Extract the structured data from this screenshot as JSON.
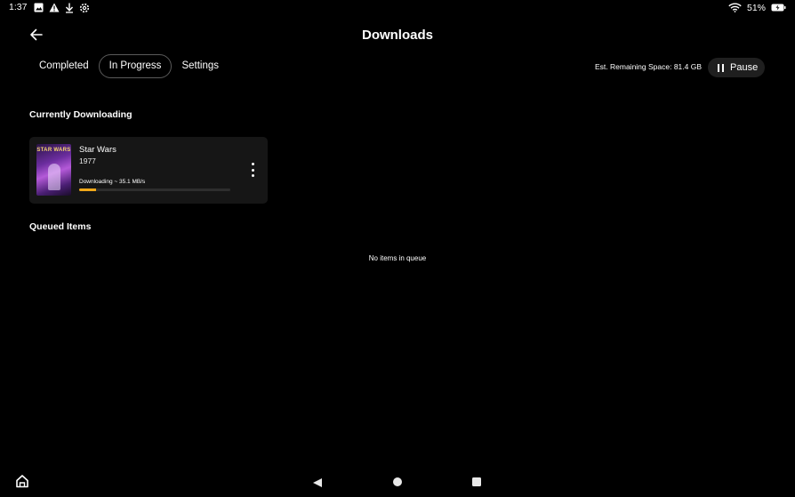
{
  "status_bar": {
    "time": "1:37",
    "left_icons": [
      "image-icon",
      "warning-icon",
      "download-icon",
      "settings-gear-icon"
    ],
    "battery_percent": "51%",
    "right_icons": [
      "wifi-icon",
      "battery-charging-icon"
    ]
  },
  "header": {
    "title": "Downloads",
    "back_icon": "back-arrow-icon"
  },
  "tabs": [
    {
      "label": "Completed",
      "active": false
    },
    {
      "label": "In Progress",
      "active": true
    },
    {
      "label": "Settings",
      "active": false
    }
  ],
  "storage": {
    "remaining_text": "Est. Remaining Space: 81.4 GB"
  },
  "pause_button": {
    "label": "Pause",
    "icon": "pause-icon"
  },
  "sections": {
    "currently_downloading": {
      "heading": "Currently Downloading",
      "items": [
        {
          "title": "Star Wars",
          "year": "1977",
          "status": "Downloading ~ 35.1 MB/s",
          "progress": 0.11,
          "poster_text": "STAR WARS",
          "progress_color": "#f0a81a"
        }
      ]
    },
    "queued": {
      "heading": "Queued Items",
      "empty_text": "No items in queue"
    }
  },
  "nav_bar": {
    "icons": [
      "home-icon",
      "nav-back-icon",
      "nav-home-icon",
      "nav-recents-icon"
    ]
  },
  "colors": {
    "background": "#000000",
    "card": "#161616",
    "accent": "#f0a81a",
    "pause_button_bg": "#1f1f1f"
  }
}
